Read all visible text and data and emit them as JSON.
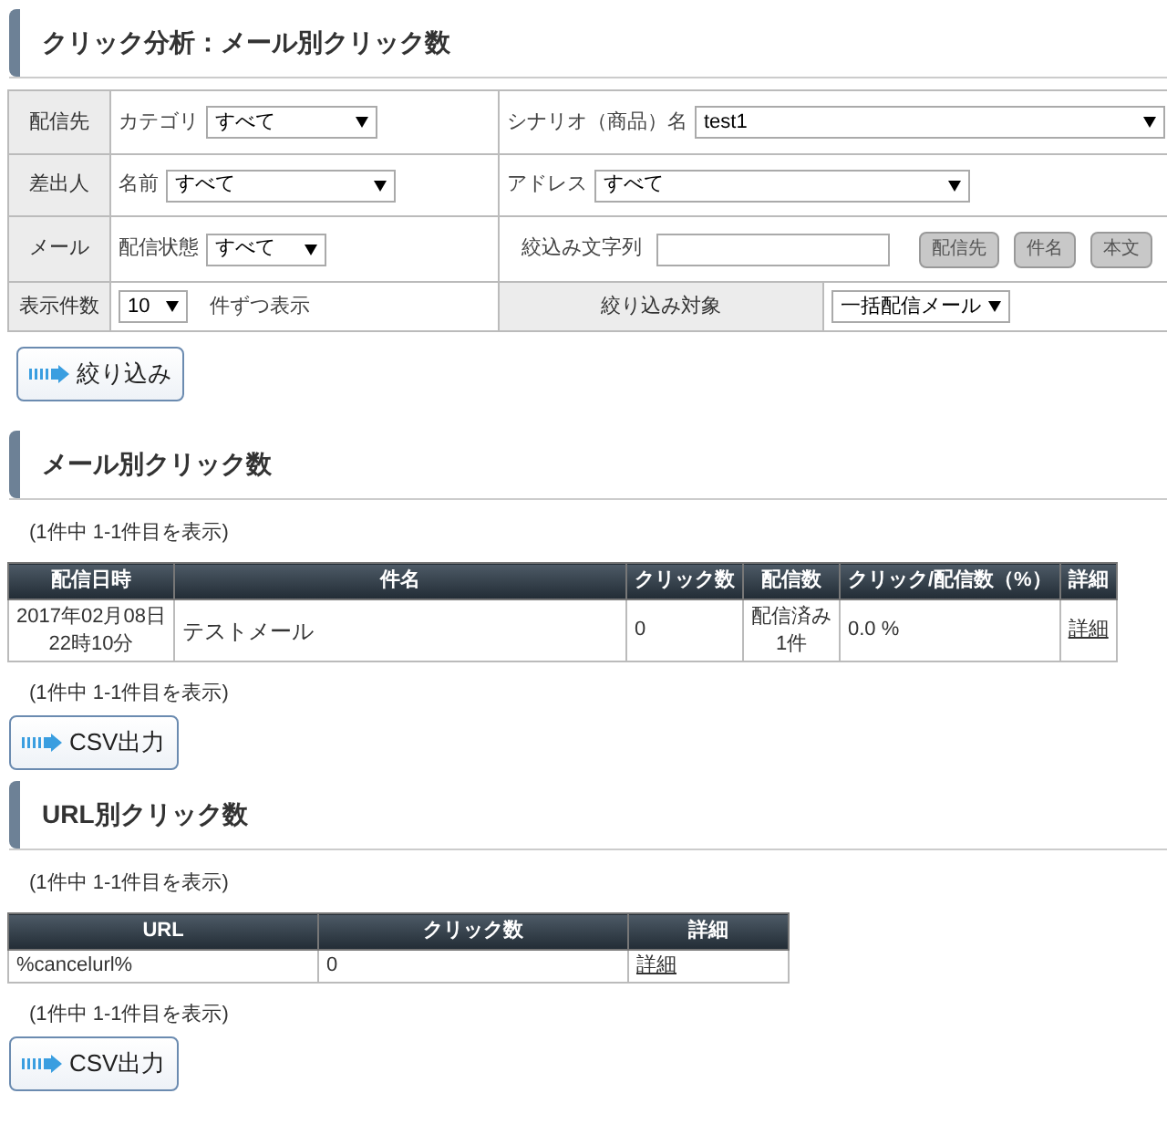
{
  "page_title": "クリック分析：メール別クリック数",
  "filter": {
    "recipient": {
      "label": "配信先",
      "category_label": "カテゴリ",
      "category_value": "すべて",
      "scenario_label": "シナリオ（商品）名",
      "scenario_value": "test1"
    },
    "sender": {
      "label": "差出人",
      "name_label": "名前",
      "name_value": "すべて",
      "address_label": "アドレス",
      "address_value": "すべて"
    },
    "mail": {
      "label": "メール",
      "status_label": "配信状態",
      "status_value": "すべて",
      "keyword_label": "絞込み文字列",
      "target_buttons": [
        "配信先",
        "件名",
        "本文"
      ]
    },
    "display": {
      "label": "表示件数",
      "count_value": "10",
      "count_suffix": "件ずつ表示",
      "target_label": "絞り込み対象",
      "target_value": "一括配信メール"
    }
  },
  "filter_button": "絞り込み",
  "mail_section": {
    "title": "メール別クリック数",
    "summary_top": "(1件中 1-1件目を表示)",
    "columns": [
      "配信日時",
      "件名",
      "クリック数",
      "配信数",
      "クリック/配信数（%）",
      "詳細"
    ],
    "rows": [
      {
        "date": "2017年02月08日",
        "time": "22時10分",
        "subject": "テストメール",
        "clicks": "0",
        "sent_status": "配信済み",
        "sent_count": "1件",
        "ratio": "0.0 %",
        "detail": "詳細"
      }
    ],
    "summary_bottom": "(1件中 1-1件目を表示)",
    "export_button": "CSV出力"
  },
  "url_section": {
    "title": "URL別クリック数",
    "summary_top": "(1件中 1-1件目を表示)",
    "columns": [
      "URL",
      "クリック数",
      "詳細"
    ],
    "rows": [
      {
        "url": "%cancelurl%",
        "clicks": "0",
        "detail": "詳細"
      }
    ],
    "summary_bottom": "(1件中 1-1件目を表示)",
    "export_button": "CSV出力"
  }
}
